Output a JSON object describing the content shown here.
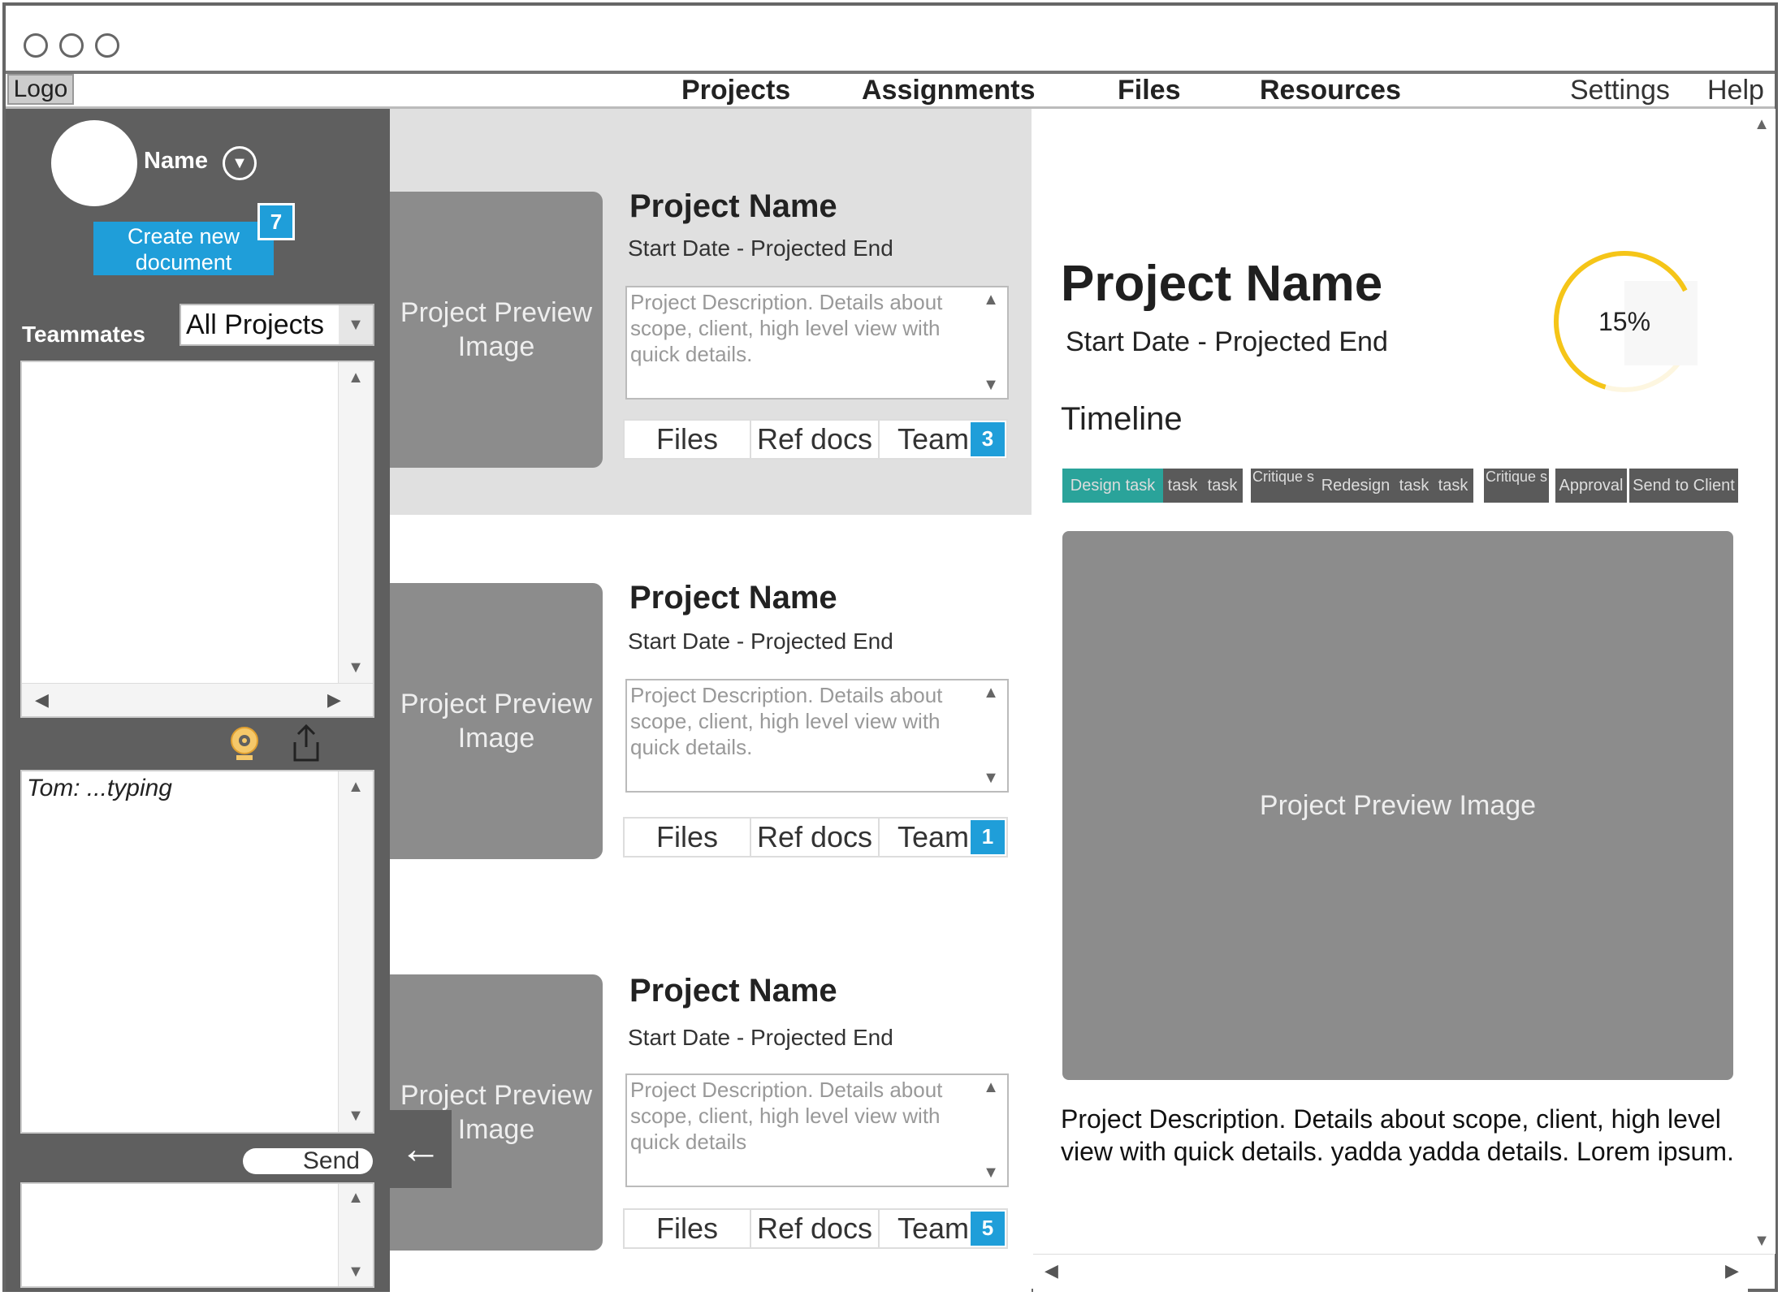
{
  "menu": {
    "logo": "Logo",
    "nav": [
      "Projects",
      "Assignments",
      "Files",
      "Resources"
    ],
    "settings": "Settings",
    "help": "Help"
  },
  "sidebar": {
    "user_name": "Name",
    "create_label_line1": "Create new",
    "create_label_line2": "document",
    "create_badge": "7",
    "teammates_label": "Teammates",
    "filter_value": "All Projects",
    "chat_typing": "Tom: ...typing",
    "send_label": "Send",
    "back_icon": "←"
  },
  "projects": [
    {
      "title": "Project Name",
      "dates": "Start Date - Projected End",
      "description": "Project Description. Details about scope, client, high level view with quick details.",
      "image_line1": "Project Preview",
      "image_line2": "Image",
      "tabs": [
        "Files",
        "Ref docs",
        "Team"
      ],
      "badge": "3"
    },
    {
      "title": "Project Name",
      "dates": "Start Date - Projected End",
      "description": "Project Description. Details about scope, client, high level view with quick details.",
      "image_line1": "Project Preview",
      "image_line2": "Image",
      "tabs": [
        "Files",
        "Ref docs",
        "Team"
      ],
      "badge": "1"
    },
    {
      "title": "Project Name",
      "dates": "Start Date - Projected End",
      "description": "Project Description. Details about scope, client, high level view with quick details",
      "image_line1": "Project Preview",
      "image_line2": "Image",
      "tabs": [
        "Files",
        "Ref docs",
        "Team"
      ],
      "badge": "5"
    }
  ],
  "detail": {
    "title": "Project Name",
    "dates": "Start Date - Projected End",
    "progress_label": "15%",
    "progress_fraction": 0.15,
    "timeline_label": "Timeline",
    "timeline": [
      "Design task",
      "task",
      "task",
      "Critique s",
      "Redesign",
      "task",
      "task",
      "Critique s",
      "Approval",
      "Send to Client"
    ],
    "preview_label": "Project Preview Image",
    "description": "Project Description. Details about scope, client, high level view with quick details. yadda yadda details. Lorem ipsum."
  },
  "colors": {
    "accent": "#1f9ed9",
    "timeline_active": "#2aa39a",
    "progress": "#f5c518",
    "sidebar": "#5f5f5f"
  }
}
